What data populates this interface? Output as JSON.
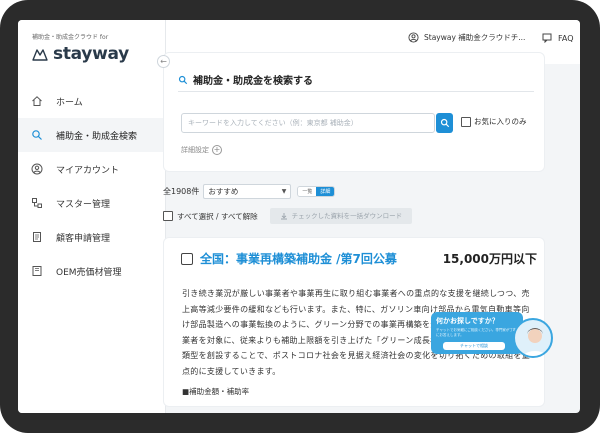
{
  "sidebar": {
    "brand_sub": "補助金・助成金クラウド for",
    "brand_name": "stayway",
    "collapse_glyph": "←",
    "items": [
      {
        "label": "ホーム",
        "icon": "home-icon"
      },
      {
        "label": "補助金・助成金検索",
        "icon": "search-icon",
        "active": true
      },
      {
        "label": "マイアカウント",
        "icon": "user-icon"
      },
      {
        "label": "マスター管理",
        "icon": "master-icon"
      },
      {
        "label": "顧客申請管理",
        "icon": "document-icon"
      },
      {
        "label": "OEM売価材管理",
        "icon": "folder-icon"
      }
    ]
  },
  "topbar": {
    "user_label": "Stayway 補助金クラウドチ...",
    "faq_label": "FAQ"
  },
  "search": {
    "title": "補助金・助成金を検索する",
    "placeholder": "キーワードを入力してください（例：東京都 補助金）",
    "favorites_label": "お気に入りのみ",
    "detail_label": "詳細設定"
  },
  "results": {
    "count_label": "全1908件",
    "sort_value": "おすすめ",
    "view_list": "一覧",
    "view_detail": "詳細"
  },
  "bulk": {
    "select_all_label": "すべて選択 / すべて解除",
    "download_label": "チェックした資料を一括ダウンロード"
  },
  "card": {
    "title": "全国：事業再構築補助金 /第7回公募",
    "amount": "15,000万円以下",
    "body": "引き続き業況が厳しい事業者や事業再生に取り組む事業者への重点的な支援を継続しつつ、売上高等減少要件の緩和なども行います。また、特に、ガソリン車向け部品から電気自動車等向け部品製造への事業転換のように、グリーン分野での事業再構築を通じて高い成長を目指す事業者を対象に、従来よりも補助上限額を引き上げた「グリーン成長枠」を徹底した新たな申請類型を創設することで、ポストコロナ社会を見据え経済社会の変化を切り拓くための取組を重点的に支援していきます。",
    "section_label": "■補助金額・補助率"
  },
  "chat": {
    "title": "何かお探しですか？",
    "sub": "チャットでお気軽にご相談ください。専門家が丁寧にお答えします。",
    "button": "チャットで相談"
  }
}
